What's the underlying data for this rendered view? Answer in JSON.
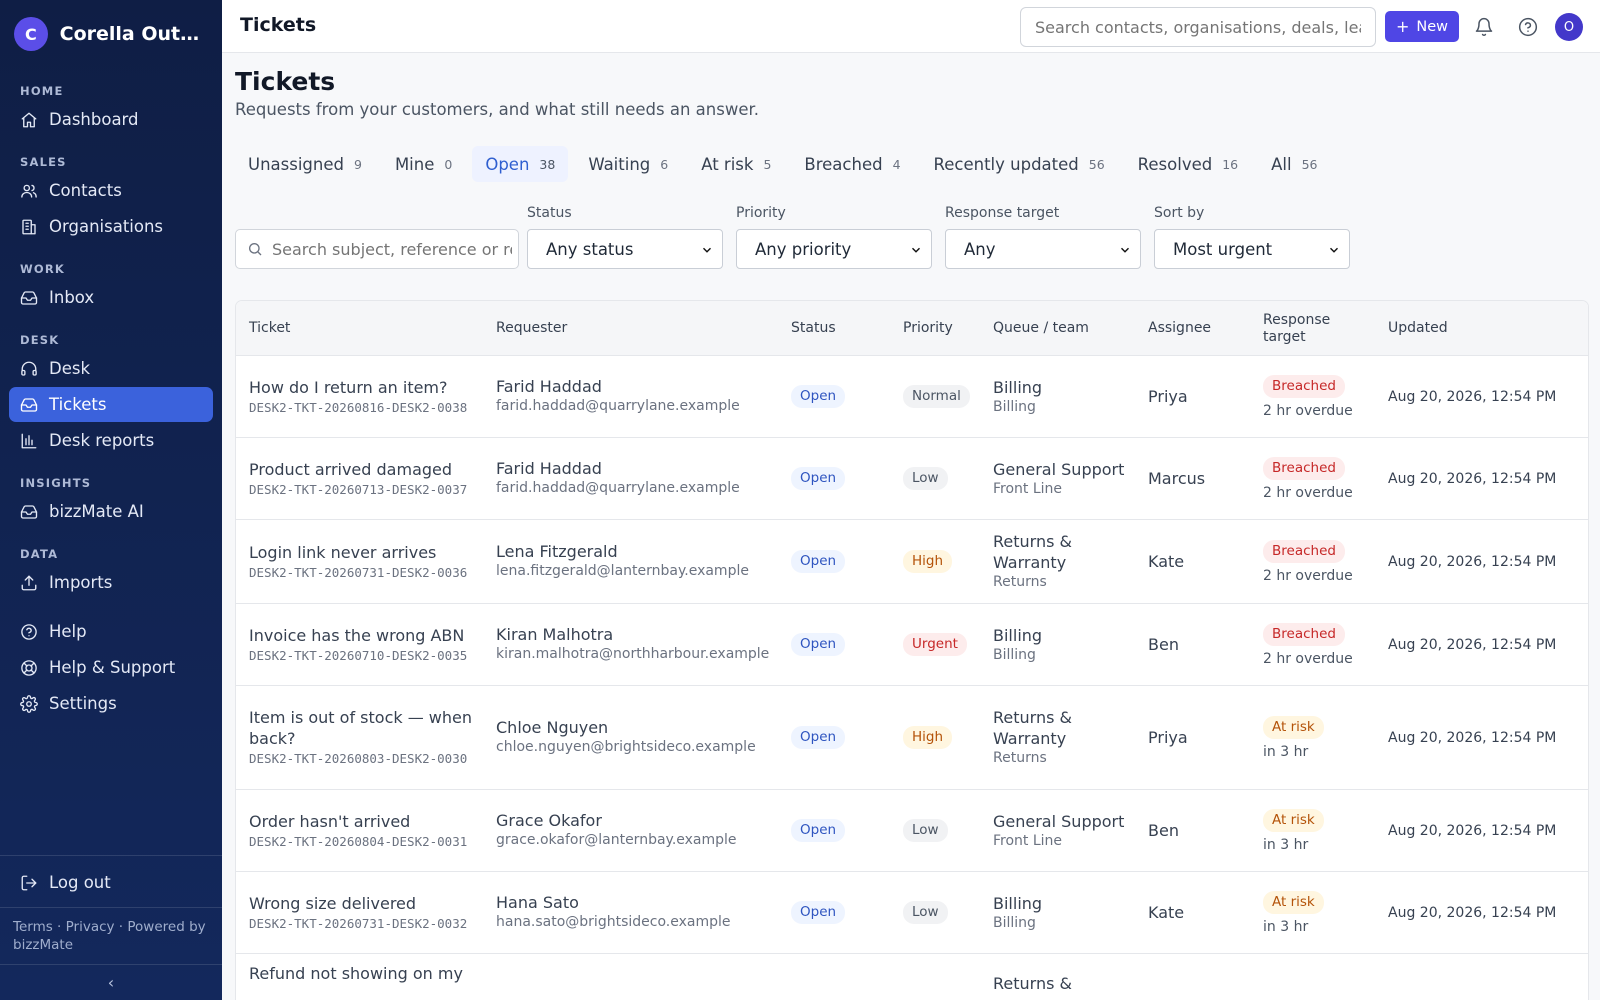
{
  "brand": {
    "initial": "C",
    "name": "Corella Outdoor Co."
  },
  "sidebar": {
    "sections": [
      {
        "label": "HOME",
        "items": [
          {
            "label": "Dashboard",
            "icon": "home-icon"
          }
        ]
      },
      {
        "label": "SALES",
        "items": [
          {
            "label": "Contacts",
            "icon": "users-icon"
          },
          {
            "label": "Organisations",
            "icon": "building-icon"
          }
        ]
      },
      {
        "label": "WORK",
        "items": [
          {
            "label": "Inbox",
            "icon": "inbox-icon"
          }
        ]
      },
      {
        "label": "DESK",
        "items": [
          {
            "label": "Desk",
            "icon": "headset-icon"
          },
          {
            "label": "Tickets",
            "icon": "inbox-icon",
            "active": true
          },
          {
            "label": "Desk reports",
            "icon": "bar-chart-icon"
          }
        ]
      },
      {
        "label": "INSIGHTS",
        "items": [
          {
            "label": "bizzMate AI",
            "icon": "inbox-icon"
          }
        ]
      },
      {
        "label": "DATA",
        "items": [
          {
            "label": "Imports",
            "icon": "upload-icon"
          }
        ]
      }
    ],
    "utility": [
      {
        "label": "Help",
        "icon": "help-icon"
      },
      {
        "label": "Help & Support",
        "icon": "lifebuoy-icon"
      },
      {
        "label": "Settings",
        "icon": "gear-icon"
      }
    ],
    "logout": "Log out",
    "footer": "Terms · Privacy · Powered by bizzMate",
    "collapse": "‹"
  },
  "topbar": {
    "title": "Tickets",
    "search_placeholder": "Search contacts, organisations, deals, leads",
    "new_label": "New",
    "avatar": "O"
  },
  "page": {
    "title": "Tickets",
    "subtitle": "Requests from your customers, and what still needs an answer."
  },
  "tabs": [
    {
      "label": "Unassigned",
      "count": "9"
    },
    {
      "label": "Mine",
      "count": "0"
    },
    {
      "label": "Open",
      "count": "38",
      "active": true
    },
    {
      "label": "Waiting",
      "count": "6"
    },
    {
      "label": "At risk",
      "count": "5"
    },
    {
      "label": "Breached",
      "count": "4"
    },
    {
      "label": "Recently updated",
      "count": "56"
    },
    {
      "label": "Resolved",
      "count": "16"
    },
    {
      "label": "All",
      "count": "56"
    }
  ],
  "filters": {
    "search_placeholder": "Search subject, reference or requester",
    "status": {
      "label": "Status",
      "value": "Any status"
    },
    "priority": {
      "label": "Priority",
      "value": "Any priority"
    },
    "response_target": {
      "label": "Response target",
      "value": "Any"
    },
    "sort": {
      "label": "Sort by",
      "value": "Most urgent"
    }
  },
  "table": {
    "headers": [
      "Ticket",
      "Requester",
      "Status",
      "Priority",
      "Queue / team",
      "Assignee",
      "Response target",
      "Updated"
    ],
    "rows": [
      {
        "subject": "How do I return an item?",
        "ref": "DESK2-TKT-20260816-DESK2-0038",
        "requester": "Farid Haddad",
        "email": "farid.haddad@quarrylane.example",
        "status": "Open",
        "priority": "Normal",
        "queue": "Billing",
        "team": "Billing",
        "assignee": "Priya",
        "target": "Breached",
        "target_sub": "2 hr overdue",
        "updated": "Aug 20, 2026, 12:54 PM"
      },
      {
        "subject": "Product arrived damaged",
        "ref": "DESK2-TKT-20260713-DESK2-0037",
        "requester": "Farid Haddad",
        "email": "farid.haddad@quarrylane.example",
        "status": "Open",
        "priority": "Low",
        "queue": "General Support",
        "team": "Front Line",
        "assignee": "Marcus",
        "target": "Breached",
        "target_sub": "2 hr overdue",
        "updated": "Aug 20, 2026, 12:54 PM"
      },
      {
        "subject": "Login link never arrives",
        "ref": "DESK2-TKT-20260731-DESK2-0036",
        "requester": "Lena Fitzgerald",
        "email": "lena.fitzgerald@lanternbay.example",
        "status": "Open",
        "priority": "High",
        "queue": "Returns & Warranty",
        "team": "Returns",
        "assignee": "Kate",
        "target": "Breached",
        "target_sub": "2 hr overdue",
        "updated": "Aug 20, 2026, 12:54 PM"
      },
      {
        "subject": "Invoice has the wrong ABN",
        "ref": "DESK2-TKT-20260710-DESK2-0035",
        "requester": "Kiran Malhotra",
        "email": "kiran.malhotra@northharbour.example",
        "status": "Open",
        "priority": "Urgent",
        "queue": "Billing",
        "team": "Billing",
        "assignee": "Ben",
        "target": "Breached",
        "target_sub": "2 hr overdue",
        "updated": "Aug 20, 2026, 12:54 PM"
      },
      {
        "subject": "Item is out of stock — when back?",
        "ref": "DESK2-TKT-20260803-DESK2-0030",
        "requester": "Chloe Nguyen",
        "email": "chloe.nguyen@brightsideco.example",
        "status": "Open",
        "priority": "High",
        "queue": "Returns & Warranty",
        "team": "Returns",
        "assignee": "Priya",
        "target": "At risk",
        "target_sub": "in 3 hr",
        "updated": "Aug 20, 2026, 12:54 PM"
      },
      {
        "subject": "Order hasn't arrived",
        "ref": "DESK2-TKT-20260804-DESK2-0031",
        "requester": "Grace Okafor",
        "email": "grace.okafor@lanternbay.example",
        "status": "Open",
        "priority": "Low",
        "queue": "General Support",
        "team": "Front Line",
        "assignee": "Ben",
        "target": "At risk",
        "target_sub": "in 3 hr",
        "updated": "Aug 20, 2026, 12:54 PM"
      },
      {
        "subject": "Wrong size delivered",
        "ref": "DESK2-TKT-20260731-DESK2-0032",
        "requester": "Hana Sato",
        "email": "hana.sato@brightsideco.example",
        "status": "Open",
        "priority": "Low",
        "queue": "Billing",
        "team": "Billing",
        "assignee": "Kate",
        "target": "At risk",
        "target_sub": "in 3 hr",
        "updated": "Aug 20, 2026, 12:54 PM"
      },
      {
        "subject": "Refund not showing on my",
        "ref": "",
        "requester": "",
        "email": "",
        "status": "",
        "priority": "",
        "queue": "Returns &",
        "team": "",
        "assignee": "",
        "target": "",
        "target_sub": "",
        "updated": ""
      }
    ]
  }
}
